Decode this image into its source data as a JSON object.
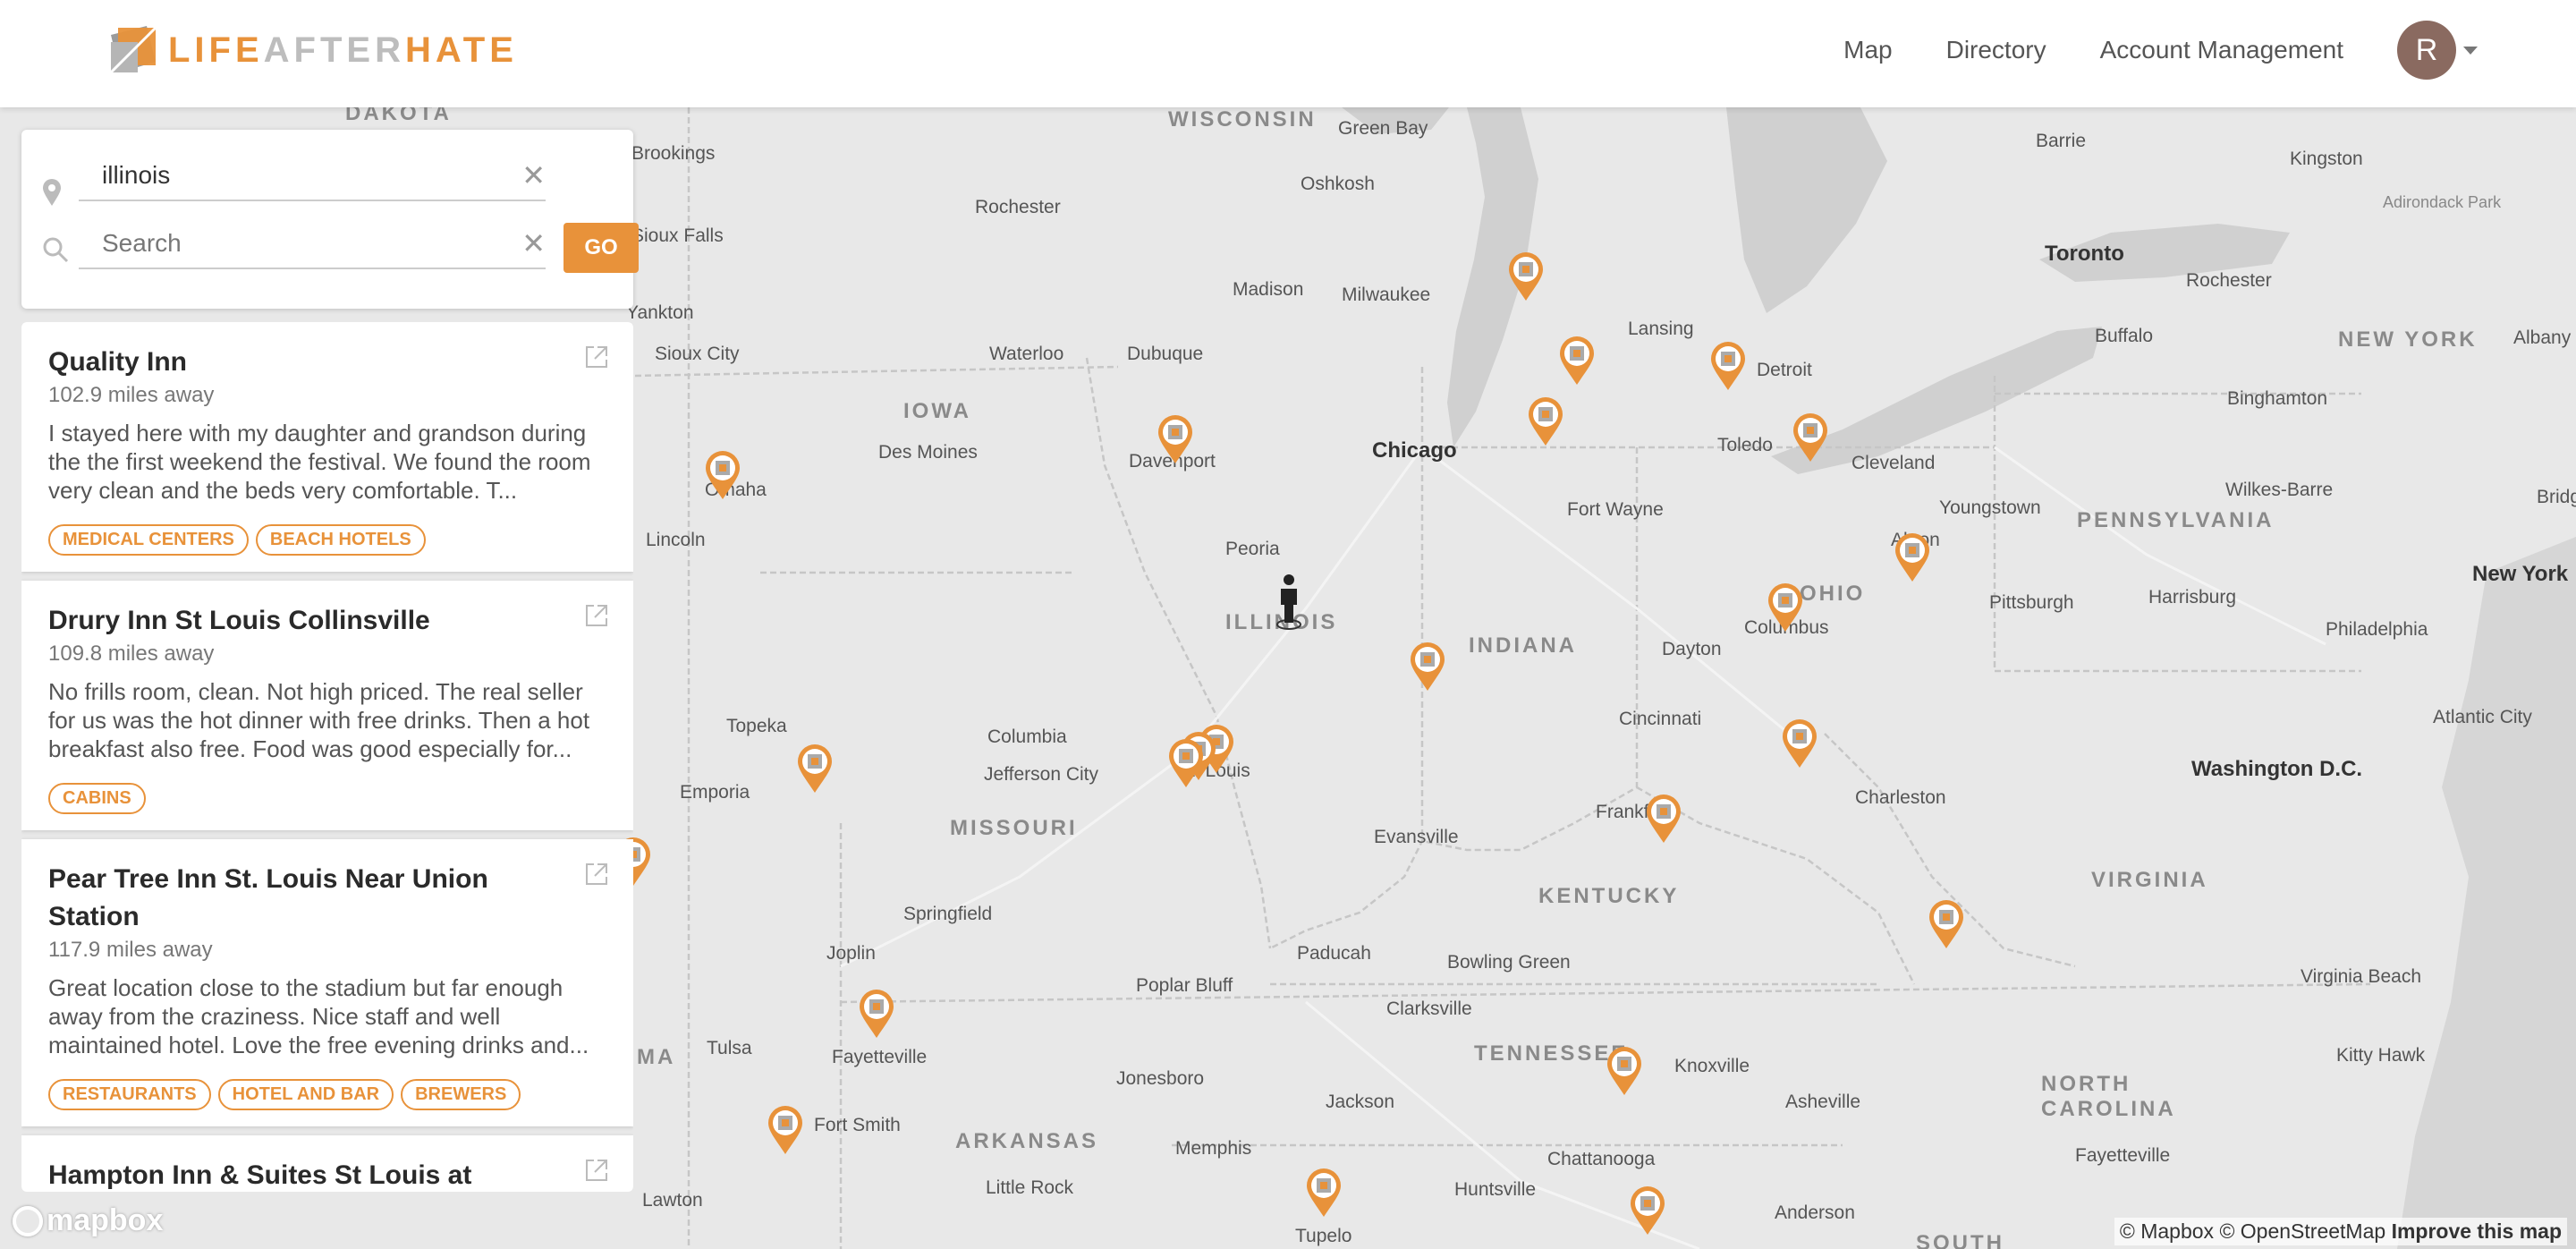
{
  "header": {
    "logo": {
      "life": "LIFE",
      "after": "AFTER",
      "hate": "HATE"
    },
    "nav": [
      "Map",
      "Directory",
      "Account Management"
    ],
    "avatar_initial": "R"
  },
  "search": {
    "location_value": "illinois",
    "search_placeholder": "Search",
    "go_label": "GO"
  },
  "results": [
    {
      "title": "Quality Inn",
      "distance": "102.9 miles away",
      "description": "I stayed here with my daughter and grandson during the the first weekend the festival. We found the room very clean and the beds very comfortable. T...",
      "tags": [
        "MEDICAL CENTERS",
        "BEACH HOTELS"
      ]
    },
    {
      "title": "Drury Inn St Louis Collinsville",
      "distance": "109.8 miles away",
      "description": "No frills room, clean. Not high priced. The real seller for us was the hot dinner with free drinks. Then a hot breakfast also free. Food was good especially for...",
      "tags": [
        "CABINS"
      ]
    },
    {
      "title": "Pear Tree Inn St. Louis Near Union Station",
      "distance": "117.9 miles away",
      "description": "Great location close to the stadium but far enough away from the craziness. Nice staff and well maintained hotel. Love the free evening drinks and...",
      "tags": [
        "RESTAURANTS",
        "HOTEL AND BAR",
        "BREWERS"
      ]
    },
    {
      "title": "Hampton Inn & Suites St Louis at Forest",
      "distance": "",
      "description": "",
      "tags": []
    }
  ],
  "map": {
    "regions": [
      "DAKOTA",
      "WISCONSIN",
      "IOWA",
      "ILLINOIS",
      "INDIANA",
      "OHIO",
      "MISSOURI",
      "KENTUCKY",
      "TENNESSEE",
      "ARKANSAS",
      "VIRGINIA",
      "NORTH",
      "CAROLINA",
      "PENNSYLVANIA",
      "NEW YORK",
      "MA",
      "SOUTH"
    ],
    "cities": [
      "Green Bay",
      "Oshkosh",
      "Madison",
      "Milwaukee",
      "Rochester",
      "Waterloo",
      "Dubuque",
      "Des Moines",
      "Davenport",
      "Chicago",
      "Peoria",
      "Sioux City",
      "Sioux Falls",
      "Omaha",
      "Lincoln",
      "Lansing",
      "Detroit",
      "Toledo",
      "Cleveland",
      "Fort Wayne",
      "Youngstown",
      "Akron",
      "Columbus",
      "Dayton",
      "Cincinnati",
      "Pittsburgh",
      "Harrisburg",
      "Philadelphia",
      "New York",
      "Barrie",
      "Kingston",
      "Toronto",
      "Rochester",
      "Buffalo",
      "Binghamton",
      "Wilkes-Barre",
      "Albany",
      "Adirondack Park",
      "Topeka",
      "Emporia",
      "Columbia",
      "Jefferson City",
      "St. Louis",
      "Springfield",
      "Joplin",
      "Evansville",
      "Frankfort",
      "Charleston",
      "Washington D.C.",
      "Atlantic City",
      "Paducah",
      "Bowling Green",
      "Clarksville",
      "Poplar Bluff",
      "Tulsa",
      "Fayetteville",
      "Jonesboro",
      "Jackson",
      "Knoxville",
      "Asheville",
      "Fort Smith",
      "Memphis",
      "Chattanooga",
      "Huntsville",
      "Little Rock",
      "Tupelo",
      "Anderson",
      "Virginia Beach",
      "Kitty Hawk",
      "Fayetteville",
      "Lawton",
      "Yankton",
      "Brookings",
      "Bridgeport"
    ],
    "attribution": {
      "mapbox": "© Mapbox",
      "osm": "© OpenStreetMap",
      "improve": "Improve this map"
    },
    "mapbox_logo": "mapbox"
  }
}
